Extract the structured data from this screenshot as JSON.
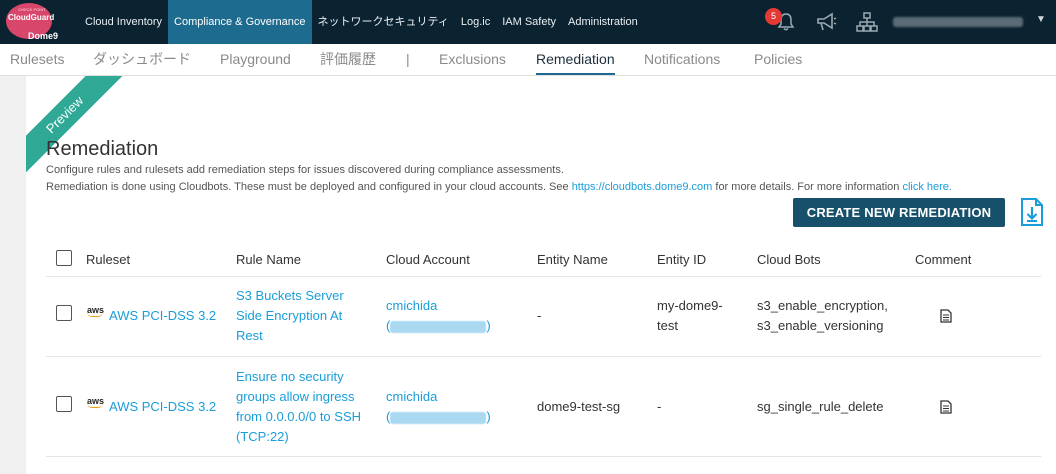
{
  "topnav": {
    "logo_text": "CloudGuard",
    "logo_sub": "Dome9",
    "items": [
      {
        "label": "Cloud Inventory",
        "active": false
      },
      {
        "label": "Compliance & Governance",
        "active": true
      },
      {
        "label": "ネットワークセキュリティ",
        "active": false
      },
      {
        "label": "Log.ic",
        "active": false
      },
      {
        "label": "IAM Safety",
        "active": false
      },
      {
        "label": "Administration",
        "active": false
      }
    ],
    "notification_count": "5"
  },
  "subtabs": [
    {
      "label": "Rulesets",
      "active": false
    },
    {
      "label": "ダッシュボード",
      "active": false
    },
    {
      "label": "Playground",
      "active": false
    },
    {
      "label": "評価履歴",
      "active": false
    },
    {
      "label": "|",
      "active": false
    },
    {
      "label": "Exclusions",
      "active": false
    },
    {
      "label": "Remediation",
      "active": true
    },
    {
      "label": "Notifications",
      "active": false
    },
    {
      "label": "Policies",
      "active": false
    }
  ],
  "page": {
    "ribbon": "Preview",
    "title": "Remediation",
    "desc_line1": "Configure rules and rulesets add remediation steps for issues discovered during compliance assessments.",
    "desc_line2_prefix": "Remediation is done using Cloudbots. These must be deployed and configured in your cloud accounts. See ",
    "desc_line2_link": "https://cloudbots.dome9.com",
    "desc_line2_mid": " for more details. For more information ",
    "desc_line2_link2": "click here.",
    "create_button": "CREATE NEW REMEDIATION"
  },
  "table": {
    "columns": [
      "Ruleset",
      "Rule Name",
      "Cloud Account",
      "Entity Name",
      "Entity ID",
      "Cloud Bots",
      "Comment"
    ],
    "rows": [
      {
        "ruleset": "AWS PCI-DSS 3.2",
        "rule_name_lines": [
          "S3 Buckets Server",
          "Side Encryption At",
          "Rest"
        ],
        "account_name": "cmichida",
        "entity_name": "-",
        "entity_id_lines": [
          "my-dome9-",
          "test"
        ],
        "cloud_bots_lines": [
          "s3_enable_encryption,",
          "s3_enable_versioning"
        ]
      },
      {
        "ruleset": "AWS PCI-DSS 3.2",
        "rule_name_lines": [
          "Ensure no security",
          "groups allow ingress",
          "from 0.0.0.0/0 to SSH",
          "(TCP:22)"
        ],
        "account_name": "cmichida",
        "entity_name": "dome9-test-sg",
        "entity_id_lines": [
          "-"
        ],
        "cloud_bots_lines": [
          "sg_single_rule_delete"
        ]
      }
    ]
  },
  "colors": {
    "nav_bg": "#0b2330",
    "nav_active": "#1d6b8e",
    "link": "#1a9dd9",
    "button": "#17506b",
    "ribbon": "#2fa896"
  }
}
